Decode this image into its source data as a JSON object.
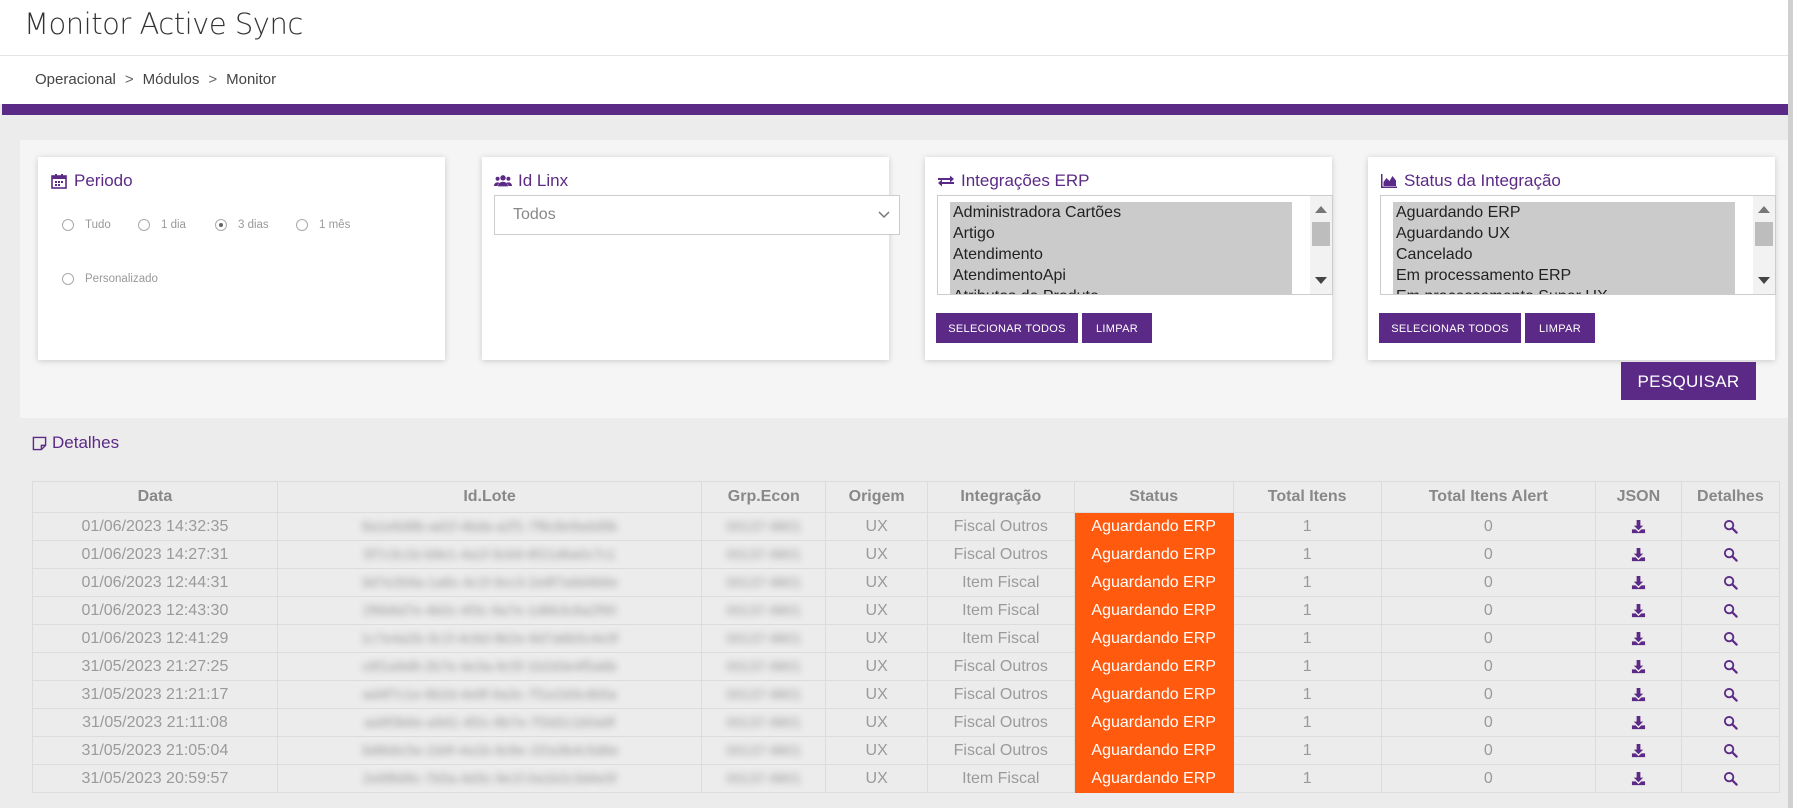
{
  "app": {
    "title": "Monitor Active Sync"
  },
  "breadcrumb": [
    "Operacional",
    ">",
    "Módulos",
    ">",
    "Monitor"
  ],
  "filters": {
    "periodo": {
      "title": "Periodo",
      "options": [
        "Tudo",
        "1 dia",
        "3 dias",
        "1 mês",
        "Personalizado"
      ],
      "selected": "3 dias"
    },
    "id_linx": {
      "title": "Id Linx",
      "value": "Todos"
    },
    "integracoes_erp": {
      "title": "Integrações ERP",
      "items": [
        "Administradora Cartões",
        "Artigo",
        "Atendimento",
        "AtendimentoApi",
        "Atributos de Produto"
      ],
      "select_all_label": "SELECIONAR TODOS",
      "clear_label": "LIMPAR"
    },
    "status_integracao": {
      "title": "Status da Integração",
      "items": [
        "Aguardando ERP",
        "Aguardando UX",
        "Cancelado",
        "Em processamento ERP",
        "Em processamento Super UX"
      ],
      "select_all_label": "SELECIONAR TODOS",
      "clear_label": "LIMPAR"
    },
    "search_label": "PESQUISAR"
  },
  "details": {
    "title": "Detalhes",
    "columns": [
      "Data",
      "Id.Lote",
      "Grp.Econ",
      "Origem",
      "Integração",
      "Status",
      "Total Itens",
      "Total Itens Alert",
      "JSON",
      "Detalhes"
    ],
    "rows": [
      [
        "01/06/2023 14:32:35",
        "8a1e6d8b-ad1f-4bda-a2f1-7f8c8e9a4d9b",
        "00137-9801",
        "UX",
        "Fiscal Outros",
        "Aguardando ERP",
        "1",
        "0"
      ],
      [
        "01/06/2023 14:27:31",
        "5f7c3c1b-b8e1-4a1f-9cb9-8f21d6a0c7c1",
        "00137-9801",
        "UX",
        "Fiscal Outros",
        "Aguardando ERP",
        "1",
        "0"
      ],
      [
        "01/06/2023 12:44:31",
        "3d7e2b9a-1a6c-4c1f-9cc3-2e8f7a9d4b6e",
        "00137-9801",
        "UX",
        "Item Fiscal",
        "Aguardando ERP",
        "1",
        "0"
      ],
      [
        "01/06/2023 12:43:30",
        "2f6b8d7e-4b0c-4f3c-9a7e-1d6b3c8a2f90",
        "00137-9801",
        "UX",
        "Item Fiscal",
        "Aguardando ERP",
        "1",
        "0"
      ],
      [
        "01/06/2023 12:41:29",
        "1c7e4a2b-3c1f-4c6d-9b2e-8d7a6b5c4e3f",
        "00137-9801",
        "UX",
        "Item Fiscal",
        "Aguardando ERP",
        "1",
        "0"
      ],
      [
        "31/05/2023 21:27:25",
        "c6f1a9d8-2b7e-4e3a-9c5f-1b2d3e4f5a6b",
        "00137-9801",
        "UX",
        "Fiscal Outros",
        "Aguardando ERP",
        "1",
        "0"
      ],
      [
        "31/05/2023 21:21:17",
        "ad4f7c1e-6b2d-4e8f-9a3c-7f1e2d3c4b5a",
        "00137-9801",
        "UX",
        "Fiscal Outros",
        "Aguardando ERP",
        "1",
        "0"
      ],
      [
        "31/05/2023 21:11:08",
        "aa9f3b6e-a9d1-4f2c-8b7e-7f3d2c1b0a9f",
        "00137-9801",
        "UX",
        "Fiscal Outros",
        "Aguardando ERP",
        "1",
        "0"
      ],
      [
        "31/05/2023 21:05:04",
        "3d8b6c5e-2d4f-4a1b-9c8e-1f2a3b4c5d6e",
        "00137-9801",
        "UX",
        "Fiscal Outros",
        "Aguardando ERP",
        "1",
        "0"
      ],
      [
        "31/05/2023 20:59:57",
        "2e6f8d9c-7b5a-4d3c-9e1f-0a1b2c3d4e5f",
        "00137-9801",
        "UX",
        "Item Fiscal",
        "Aguardando ERP",
        "1",
        "0"
      ]
    ]
  },
  "colors": {
    "accent": "#5b2a86",
    "status_waiting": "#ff5a0d"
  },
  "icons": {
    "periodo": "calendar-icon",
    "id_linx": "users-icon",
    "integracoes": "exchange-icon",
    "status": "area-chart-icon",
    "detalhes": "note-icon",
    "json": "download-icon",
    "detalhes_col": "search-icon"
  }
}
